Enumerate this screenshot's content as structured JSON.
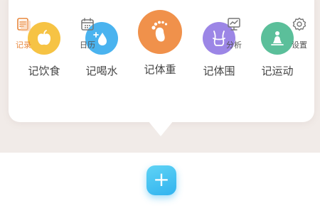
{
  "popup": {
    "items": [
      {
        "label": "记饮食",
        "icon": "apple-icon",
        "color": "#f6c344"
      },
      {
        "label": "记喝水",
        "icon": "water-drop-icon",
        "color": "#4ab3ef"
      },
      {
        "label": "记体重",
        "icon": "footprint-icon",
        "color": "#f0914b"
      },
      {
        "label": "记体围",
        "icon": "body-measure-icon",
        "color": "#9c86e6"
      },
      {
        "label": "记运动",
        "icon": "exercise-icon",
        "color": "#5bbf9a"
      }
    ]
  },
  "tabbar": {
    "tabs": [
      {
        "label": "记录",
        "icon": "record-icon",
        "active": true
      },
      {
        "label": "日历",
        "icon": "calendar-icon"
      },
      {
        "label": "分析",
        "icon": "analysis-icon"
      },
      {
        "label": "设置",
        "icon": "settings-icon"
      }
    ],
    "add_button": {
      "icon": "plus-icon",
      "label": "+"
    }
  }
}
